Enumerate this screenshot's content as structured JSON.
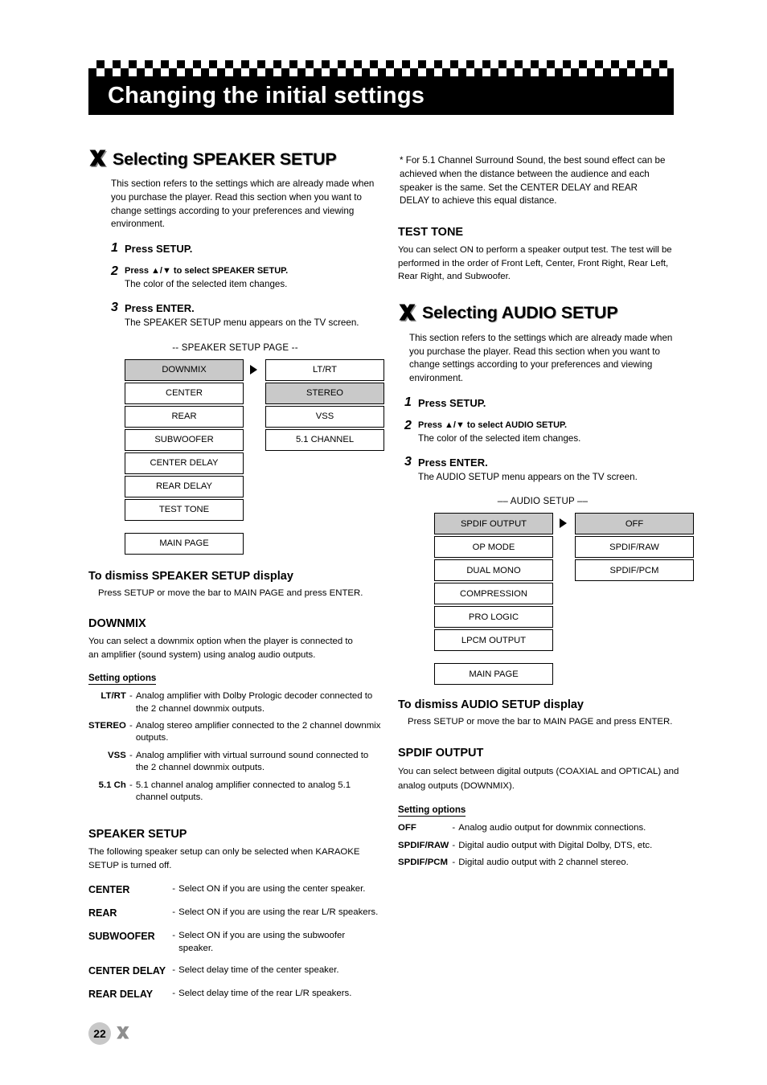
{
  "header": {
    "title": "Changing the initial settings"
  },
  "page_number": "22",
  "left": {
    "section_title_prefix": "Selecting ",
    "section_title_main": "SPEAKER SETUP",
    "intro": "This section refers to the settings which are already made when you purchase the player. Read this section when you want to change settings according to your preferences and viewing environment.",
    "steps": [
      {
        "num": "1",
        "title": "Press SETUP.",
        "sub": ""
      },
      {
        "num": "2",
        "title": "Press ▲/▼ to select SPEAKER SETUP.",
        "sub": "The color of the selected item changes."
      },
      {
        "num": "3",
        "title": "Press ENTER.",
        "sub": "The SPEAKER SETUP menu appears on the TV screen."
      }
    ],
    "menu_caption": "-- SPEAKER SETUP PAGE --",
    "menu_col1": [
      "DOWNMIX",
      "CENTER",
      "REAR",
      "SUBWOOFER",
      "CENTER DELAY",
      "REAR DELAY",
      "TEST TONE"
    ],
    "menu_col1_main": "MAIN PAGE",
    "menu_col2": [
      "LT/RT",
      "STEREO",
      "VSS",
      "5.1 CHANNEL"
    ],
    "menu_col1_selected_index": 0,
    "menu_col2_selected_index": 1,
    "dismiss_heading": "To dismiss SPEAKER SETUP display",
    "dismiss_text": "Press SETUP or move the bar to MAIN PAGE and press ENTER.",
    "downmix_heading": "DOWNMIX",
    "downmix_text": "You can select a downmix option when the player is connected to an amplifier (sound system) using analog audio outputs.",
    "setting_options_label": "Setting options",
    "downmix_options": [
      {
        "key": "LT/RT",
        "value": "Analog amplifier with Dolby Prologic decoder connected to the 2 channel downmix outputs."
      },
      {
        "key": "STEREO",
        "value": "Analog stereo amplifier connected to the 2 channel downmix outputs."
      },
      {
        "key": "VSS",
        "value": "Analog amplifier with virtual surround sound connected to the 2 channel downmix outputs."
      },
      {
        "key": "5.1 Ch",
        "value": "5.1 channel analog amplifier connected to analog 5.1 channel outputs."
      }
    ],
    "speaker_heading": "SPEAKER SETUP",
    "speaker_text": "The following speaker setup can only be selected when KARAOKE SETUP is turned off.",
    "speaker_options": [
      {
        "key": "CENTER",
        "value": "Select ON if you are using the center speaker."
      },
      {
        "key": "REAR",
        "value": "Select ON if you are using the rear L/R speakers."
      },
      {
        "key": "SUBWOOFER",
        "value": "Select ON if you are using the subwoofer speaker."
      },
      {
        "key": "CENTER DELAY",
        "value": "Select delay time of the center speaker."
      },
      {
        "key": "REAR DELAY",
        "value": "Select delay time of the rear L/R speakers."
      }
    ]
  },
  "right": {
    "note": "* For 5.1 Channel Surround Sound, the best sound effect can be achieved when the distance between the audience and each speaker is the same. Set the CENTER DELAY and REAR DELAY to achieve this equal distance.",
    "test_tone_heading": "TEST TONE",
    "test_tone_text": "You can select ON to perform a speaker output test.  The test will be performed in the order of Front Left, Center, Front Right, Rear Left, Rear Right, and Subwoofer.",
    "section_title_prefix": "Selecting ",
    "section_title_main": "AUDIO SETUP",
    "intro": "This section refers to the settings which are already made when you purchase the player. Read this section when you want to change settings according to your preferences and viewing environment.",
    "steps": [
      {
        "num": "1",
        "title": "Press SETUP.",
        "sub": ""
      },
      {
        "num": "2",
        "title": "Press ▲/▼ to select AUDIO SETUP.",
        "sub": "The color of the selected item changes."
      },
      {
        "num": "3",
        "title": "Press ENTER.",
        "sub": "The AUDIO SETUP menu appears on the TV screen."
      }
    ],
    "menu_caption": "–– AUDIO SETUP ––",
    "menu_col1": [
      "SPDIF OUTPUT",
      "OP MODE",
      "DUAL MONO",
      "COMPRESSION",
      "PRO LOGIC",
      "LPCM OUTPUT"
    ],
    "menu_col1_main": "MAIN PAGE",
    "menu_col2": [
      "OFF",
      "SPDIF/RAW",
      "SPDIF/PCM"
    ],
    "menu_col1_selected_index": 0,
    "dismiss_heading": "To dismiss AUDIO SETUP display",
    "dismiss_text": "Press SETUP or move the bar to MAIN PAGE and press ENTER.",
    "spdif_heading": "SPDIF OUTPUT",
    "spdif_text": "You can select between digital outputs (COAXIAL and OPTICAL) and analog outputs (DOWNMIX).",
    "setting_options_label": "Setting options",
    "spdif_options": [
      {
        "key": "OFF",
        "value": "Analog audio output for downmix connections."
      },
      {
        "key": "SPDIF/RAW",
        "value": "Digital audio output with Digital Dolby, DTS, etc."
      },
      {
        "key": "SPDIF/PCM",
        "value": "Digital audio output with 2 channel stereo."
      }
    ]
  },
  "colors": {
    "selected_bg": "#c9c9c9",
    "header_bg": "#000000",
    "page_circle": "#c8c8c8"
  }
}
